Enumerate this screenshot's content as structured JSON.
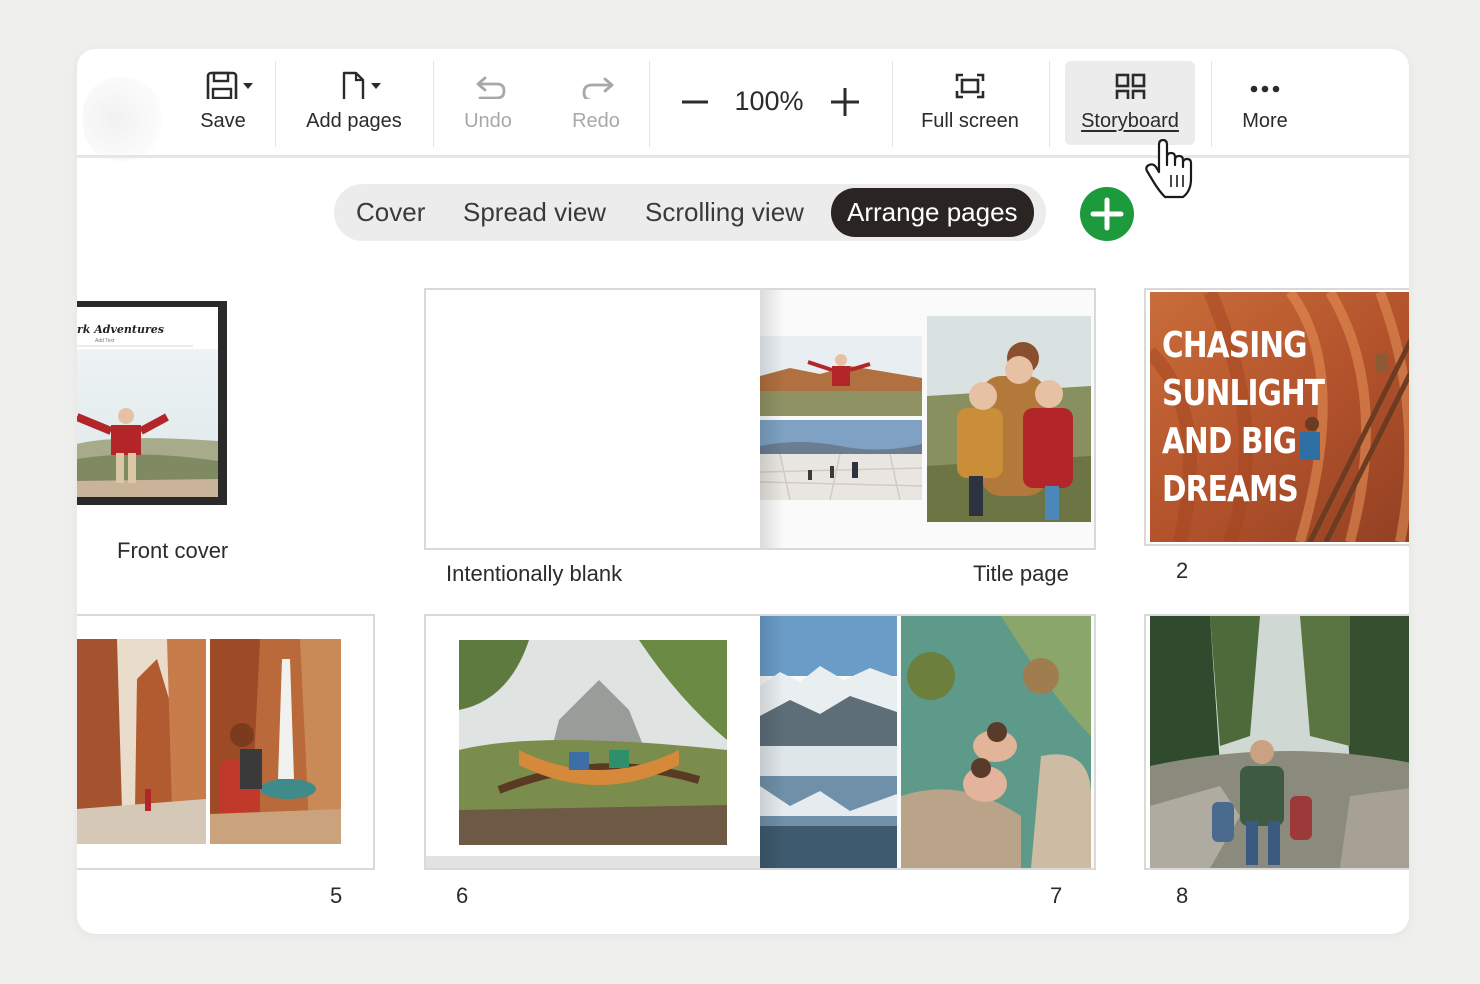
{
  "toolbar": {
    "save_label": "Save",
    "add_pages_label": "Add pages",
    "undo_label": "Undo",
    "redo_label": "Redo",
    "zoom_value": "100%",
    "full_screen_label": "Full screen",
    "storyboard_label": "Storyboard",
    "more_label": "More"
  },
  "view_tabs": {
    "cover": "Cover",
    "spread_view": "Spread view",
    "scrolling_view": "Scrolling view",
    "arrange_pages": "Arrange pages",
    "active": "Arrange pages"
  },
  "pages": {
    "front_cover": {
      "label": "Front cover",
      "title_text": "rk Adventures",
      "subtitle_text": "Add Text"
    },
    "intentionally_blank": {
      "label": "Intentionally blank"
    },
    "title_page": {
      "label": "Title page"
    },
    "page_2": {
      "label": "2",
      "title_text": "CHASING SUNLIGHT AND BIG DREAMS"
    },
    "page_5": {
      "label": "5"
    },
    "page_6": {
      "label": "6"
    },
    "page_7": {
      "label": "7"
    },
    "page_8": {
      "label": "8"
    }
  },
  "colors": {
    "background": "#efefed",
    "active_tab": "#2a2523",
    "add_button": "#1c9a3c",
    "disabled_text": "#a8a8a8"
  },
  "icons": {
    "save": "floppy-disk-icon",
    "add_pages": "page-plus-icon",
    "undo": "undo-arrow-icon",
    "redo": "redo-arrow-icon",
    "zoom_out": "minus-icon",
    "zoom_in": "plus-icon",
    "full_screen": "full-screen-icon",
    "storyboard": "grid-icon",
    "more": "ellipsis-icon",
    "add": "plus-circle-icon",
    "cursor": "hand-pointer-icon"
  }
}
